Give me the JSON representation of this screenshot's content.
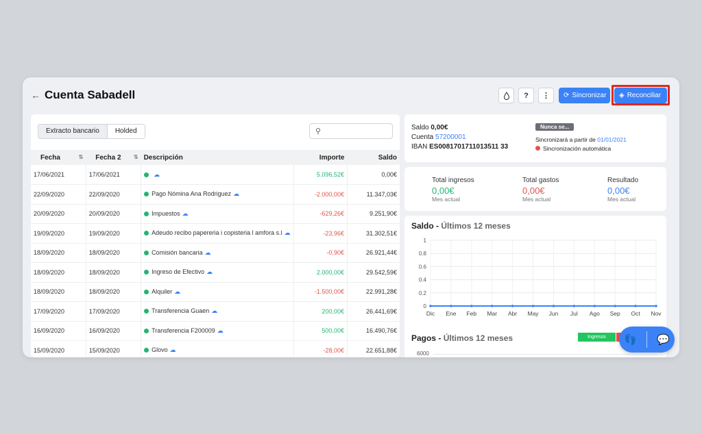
{
  "header": {
    "back_icon": "arrow-left-icon",
    "title": "Cuenta Sabadell",
    "buttons": {
      "drop_icon": "drop-icon",
      "help_icon": "question-icon",
      "more_icon": "more-vertical-icon",
      "sync_label": "Sincronizar",
      "reconcile_label": "Reconciliar"
    }
  },
  "tabs": [
    "Extracto bancario",
    "Holded"
  ],
  "search": {
    "placeholder": ""
  },
  "table": {
    "columns": [
      "Fecha",
      "Fecha 2",
      "Descripción",
      "Importe",
      "Saldo"
    ],
    "rows": [
      {
        "fecha": "17/06/2021",
        "fecha2": "17/06/2021",
        "desc": "",
        "importe": "5.096,52€",
        "saldo": "0,00€",
        "sign": "pos"
      },
      {
        "fecha": "22/09/2020",
        "fecha2": "22/09/2020",
        "desc": "Pago Nómina Ana Rodriguez",
        "importe": "-2.000,00€",
        "saldo": "11.347,03€",
        "sign": "neg"
      },
      {
        "fecha": "20/09/2020",
        "fecha2": "20/09/2020",
        "desc": "Impuestos",
        "importe": "-629,26€",
        "saldo": "9.251,90€",
        "sign": "neg"
      },
      {
        "fecha": "19/09/2020",
        "fecha2": "19/09/2020",
        "desc": "Adeudo recibo papereria i copisteria l amfora s.l",
        "importe": "-23,96€",
        "saldo": "31.302,51€",
        "sign": "neg"
      },
      {
        "fecha": "18/09/2020",
        "fecha2": "18/09/2020",
        "desc": "Comisión bancaria",
        "importe": "-0,90€",
        "saldo": "26.921,44€",
        "sign": "neg"
      },
      {
        "fecha": "18/09/2020",
        "fecha2": "18/09/2020",
        "desc": "Ingreso de Efectivo",
        "importe": "2.000,00€",
        "saldo": "29.542,59€",
        "sign": "pos"
      },
      {
        "fecha": "18/09/2020",
        "fecha2": "18/09/2020",
        "desc": "Alquiler",
        "importe": "-1.500,00€",
        "saldo": "22.991,28€",
        "sign": "neg"
      },
      {
        "fecha": "17/09/2020",
        "fecha2": "17/09/2020",
        "desc": "Transferencia Guaen",
        "importe": "200,00€",
        "saldo": "26.441,69€",
        "sign": "pos"
      },
      {
        "fecha": "16/09/2020",
        "fecha2": "16/09/2020",
        "desc": "Transferencia F200009",
        "importe": "500,00€",
        "saldo": "16.490,76€",
        "sign": "pos"
      },
      {
        "fecha": "15/09/2020",
        "fecha2": "15/09/2020",
        "desc": "Glovo",
        "importe": "-28,00€",
        "saldo": "22.651,88€",
        "sign": "neg"
      }
    ]
  },
  "account": {
    "saldo_label": "Saldo",
    "saldo_value": "0,00€",
    "cuenta_label": "Cuenta",
    "cuenta_value": "57200001",
    "iban_label": "IBAN",
    "iban_value": "ES0081701711013511 33",
    "badge": "Nunca se...",
    "sync_text": "Sincronizará a partir de",
    "sync_date": "01/01/2021",
    "auto_sync": "Sincronización automática"
  },
  "stats": [
    {
      "title": "Total ingresos",
      "value": "0,00€",
      "sub": "Mes actual",
      "color": "#22b573"
    },
    {
      "title": "Total gastos",
      "value": "0,00€",
      "sub": "Mes actual",
      "color": "#e5534b"
    },
    {
      "title": "Resultado",
      "value": "0,00€",
      "sub": "Mes actual",
      "color": "#3b82f6"
    }
  ],
  "saldo_chart": {
    "title_main": "Saldo -",
    "title_sub": "Últimos 12 meses"
  },
  "pagos_chart": {
    "title_main": "Pagos -",
    "title_sub": "Últimos 12 meses",
    "legend_ingresos": "Ingresos",
    "first_tick": "6000"
  },
  "chart_data": {
    "type": "line",
    "title": "Saldo - Últimos 12 meses",
    "categories": [
      "Dic",
      "Ene",
      "Feb",
      "Mar",
      "Abr",
      "May",
      "Jun",
      "Jul",
      "Ago",
      "Sep",
      "Oct",
      "Nov"
    ],
    "series": [
      {
        "values": [
          0,
          0,
          0,
          0,
          0,
          0,
          0,
          0,
          0,
          0,
          0,
          0
        ]
      }
    ],
    "ylim": [
      0,
      1
    ],
    "yticks": [
      "0",
      "0.2",
      "0.4",
      "0.6",
      "0.8",
      "1"
    ],
    "grid": true,
    "color": "#3b82f6"
  },
  "float_icons": [
    "footsteps-icon",
    "chat-icon"
  ]
}
